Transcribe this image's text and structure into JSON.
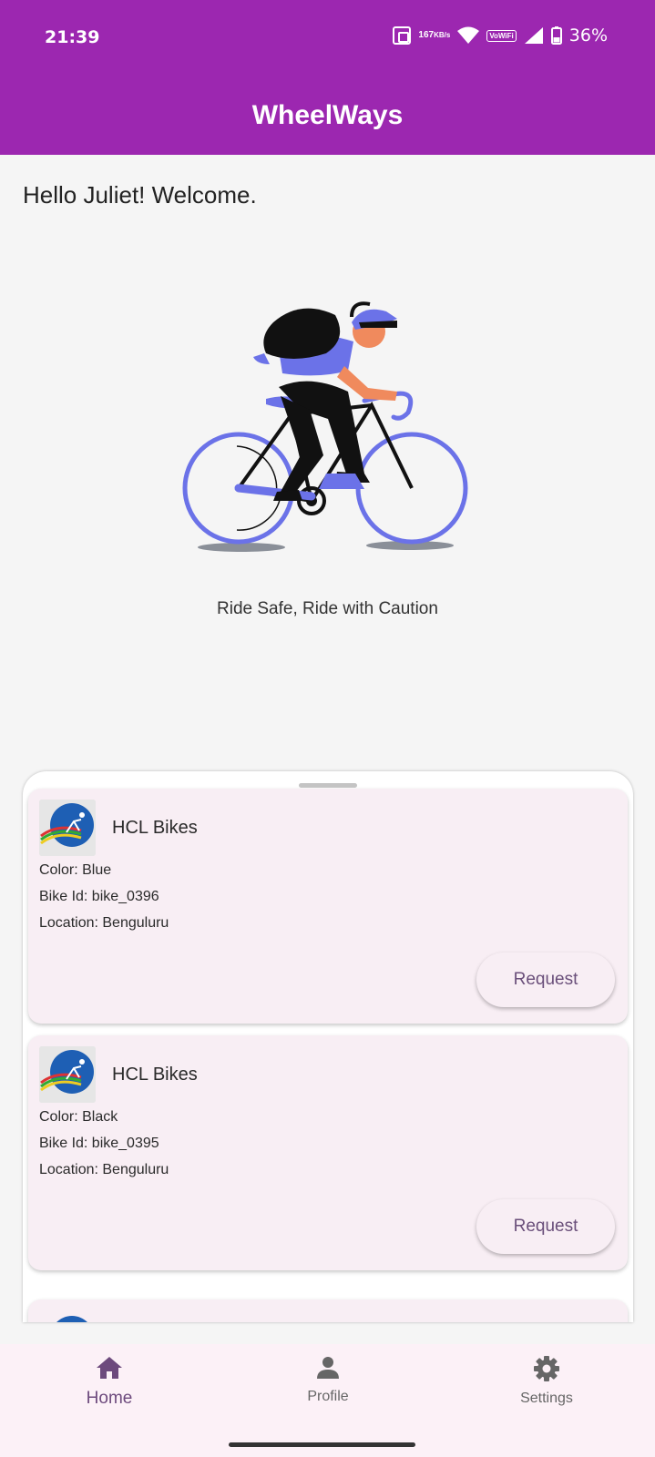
{
  "status_bar": {
    "time": "21:39",
    "net_speed_value": "167",
    "net_speed_unit": "KB/s",
    "vowifi_top": "Vo",
    "vowifi_bottom": "WiFi",
    "battery": "36%",
    "icons": [
      "nfc-icon",
      "wifi-icon",
      "signal-icon",
      "battery-icon"
    ]
  },
  "app_bar": {
    "title": "WheelWays"
  },
  "home": {
    "greeting": "Hello Juliet! Welcome.",
    "tagline": "Ride Safe, Ride with Caution"
  },
  "bikes": [
    {
      "company": "HCL Bikes",
      "color": "Color: Blue",
      "bike_id": "Bike Id: bike_0396",
      "location": "Location: Benguluru",
      "action": "Request"
    },
    {
      "company": "HCL Bikes",
      "color": "Color: Black",
      "bike_id": "Bike Id: bike_0395",
      "location": "Location: Benguluru",
      "action": "Request"
    }
  ],
  "bottom_nav": {
    "items": [
      {
        "label": "Home",
        "icon": "home-icon",
        "active": true
      },
      {
        "label": "Profile",
        "icon": "person-icon",
        "active": false
      },
      {
        "label": "Settings",
        "icon": "gear-icon",
        "active": false
      }
    ]
  },
  "colors": {
    "primary": "#9c27b0",
    "card_bg": "#f8eef4",
    "nav_bg": "#fcf1f7",
    "bike_accent": "#6b72e8",
    "active_nav": "#6d4a7d"
  }
}
